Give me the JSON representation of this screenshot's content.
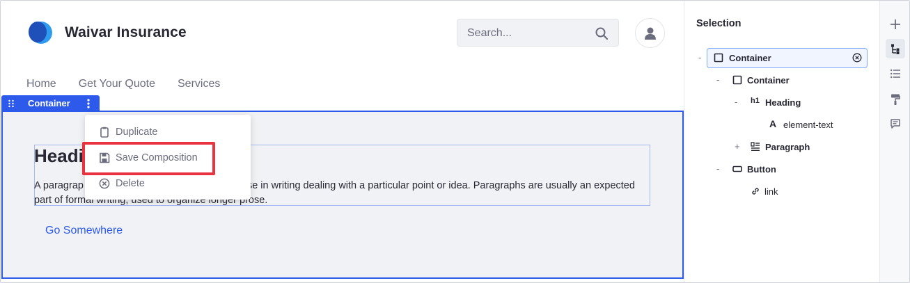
{
  "header": {
    "brand": "Waivar Insurance",
    "search_placeholder": "Search...",
    "icons": {
      "logo": "logo-icon",
      "search": "search-icon",
      "user": "user-icon"
    }
  },
  "nav": {
    "items": [
      {
        "label": "Home"
      },
      {
        "label": "Get Your Quote"
      },
      {
        "label": "Services"
      }
    ]
  },
  "selection_label": {
    "name": "Container"
  },
  "content": {
    "heading": "Heading",
    "paragraph_start": "A paragrap",
    "paragraph_line1_end": "se in writing dealing with a particular point or idea. Paragraphs are usually an expected",
    "paragraph_line2": "part of formal writing, used to organize longer prose.",
    "link": "Go Somewhere"
  },
  "menu": {
    "items": [
      {
        "label": "Duplicate",
        "icon": "duplicate-icon"
      },
      {
        "label": "Save Composition",
        "icon": "save-icon"
      },
      {
        "label": "Delete",
        "icon": "delete-icon"
      }
    ],
    "highlighted": "Save Composition",
    "highlight_color": "#ea3240"
  },
  "sidebar": {
    "title": "Selection",
    "tree": [
      {
        "label": "Container",
        "toggle": "-",
        "icon": "container-icon",
        "level": 0,
        "selected": true
      },
      {
        "label": "Container",
        "toggle": "-",
        "icon": "container-icon",
        "level": 1
      },
      {
        "label": "Heading",
        "toggle": "-",
        "icon": "heading-icon",
        "level": 2
      },
      {
        "label": "element-text",
        "toggle": "",
        "icon": "text-icon",
        "level": 3
      },
      {
        "label": "Paragraph",
        "toggle": "+",
        "icon": "paragraph-icon",
        "level": 2
      },
      {
        "label": "Button",
        "toggle": "-",
        "icon": "button-icon",
        "level": 1
      },
      {
        "label": "link",
        "toggle": "",
        "icon": "link-icon",
        "level": 2
      }
    ]
  },
  "rail": {
    "buttons": [
      "add-icon",
      "structure-tree-icon",
      "list-icon",
      "paint-roller-icon",
      "comment-icon"
    ],
    "active": "structure-tree-icon"
  },
  "colors": {
    "accent": "#2e5aeb",
    "text": "#272833",
    "muted": "#6b6c7e"
  }
}
